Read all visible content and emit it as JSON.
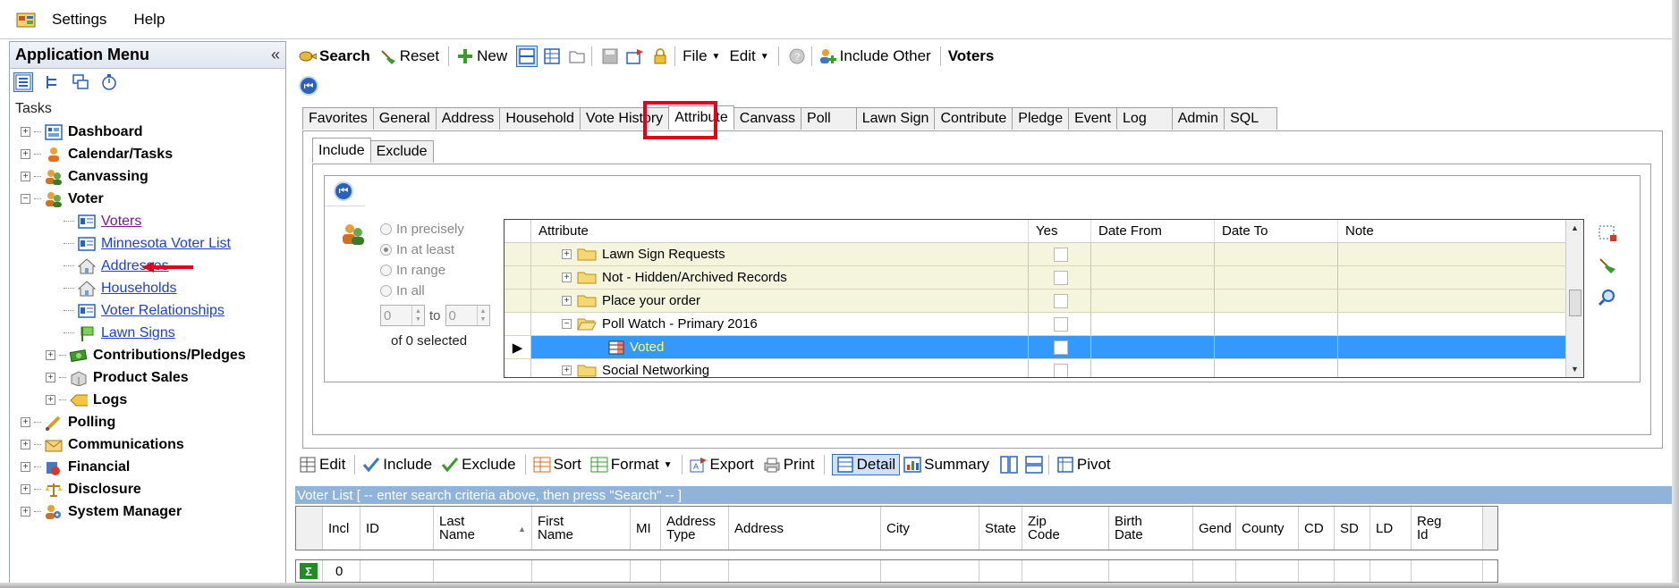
{
  "menubar": {
    "items": [
      "Settings",
      "Help"
    ]
  },
  "left_panel": {
    "title": "Application Menu",
    "collapse_glyph": "«",
    "tasks_label": "Tasks",
    "tree": [
      {
        "label": "Dashboard",
        "expander": "+",
        "icon": "dashboard-icon"
      },
      {
        "label": "Calendar/Tasks",
        "expander": "+",
        "icon": "calendar-person-icon"
      },
      {
        "label": "Canvassing",
        "expander": "+",
        "icon": "people-icon"
      },
      {
        "label": "Voter",
        "expander": "−",
        "icon": "people-icon",
        "children": [
          {
            "label": "Voters",
            "icon": "card-icon",
            "visited": true
          },
          {
            "label": "Minnesota Voter List",
            "icon": "card-icon"
          },
          {
            "label": "Addresses",
            "icon": "house-icon"
          },
          {
            "label": "Households",
            "icon": "house-icon"
          },
          {
            "label": "Voter Relationships",
            "icon": "card-icon"
          },
          {
            "label": "Lawn Signs",
            "icon": "sign-icon"
          }
        ],
        "subgroups": [
          {
            "label": "Contributions/Pledges",
            "icon": "money-icon"
          },
          {
            "label": "Product Sales",
            "icon": "box-icon"
          },
          {
            "label": "Logs",
            "icon": "tag-icon"
          }
        ]
      },
      {
        "label": "Polling",
        "expander": "+",
        "icon": "pen-icon"
      },
      {
        "label": "Communications",
        "expander": "+",
        "icon": "envelope-icon"
      },
      {
        "label": "Financial",
        "expander": "+",
        "icon": "money-bag-icon"
      },
      {
        "label": "Disclosure",
        "expander": "+",
        "icon": "scale-icon"
      },
      {
        "label": "System Manager",
        "expander": "+",
        "icon": "people-gear-icon"
      }
    ]
  },
  "toolbar": {
    "search": "Search",
    "reset": "Reset",
    "new": "New",
    "file": "File",
    "edit": "Edit",
    "include_other": "Include Other",
    "title": "Voters"
  },
  "tabs": [
    "Favorites",
    "General",
    "Address",
    "Household",
    "Vote History",
    "Attribute",
    "Canvass",
    "Poll",
    "Lawn Sign",
    "Contribute",
    "Pledge",
    "Event",
    "Log",
    "Admin",
    "SQL"
  ],
  "active_tab": "Attribute",
  "subtabs": [
    "Include",
    "Exclude"
  ],
  "options": {
    "precisely": "In precisely",
    "at_least": "In at least",
    "range": "In range",
    "all": "In all",
    "from_value": "0",
    "to_label": "to",
    "to_value": "0",
    "selected_info": "of 0 selected"
  },
  "attr_grid": {
    "columns": [
      "Attribute",
      "Yes",
      "Date From",
      "Date To",
      "Note"
    ],
    "rows": [
      {
        "label": "Lawn Sign Requests",
        "style": "yellow",
        "type": "folder"
      },
      {
        "label": "Not - Hidden/Archived Records",
        "style": "yellow",
        "type": "folder"
      },
      {
        "label": "Place your order",
        "style": "yellow",
        "type": "folder"
      },
      {
        "label": "Poll Watch - Primary 2016",
        "style": "plain",
        "type": "folder-open"
      },
      {
        "label": "Voted",
        "style": "selected",
        "type": "leaf"
      },
      {
        "label": "Social Networking",
        "style": "plain",
        "type": "folder"
      }
    ]
  },
  "bottom_toolbar": {
    "edit": "Edit",
    "include": "Include",
    "exclude": "Exclude",
    "sort": "Sort",
    "format": "Format",
    "export": "Export",
    "print": "Print",
    "detail": "Detail",
    "summary": "Summary",
    "pivot": "Pivot"
  },
  "voter_list": {
    "caption": "Voter List  [ -- enter search criteria above, then press \"Search\" -- ]",
    "columns": [
      "Incl",
      "ID",
      "Last Name",
      "First Name",
      "MI",
      "Address Type",
      "Address",
      "City",
      "State",
      "Zip Code",
      "Birth Date",
      "Gend",
      "County",
      "CD",
      "SD",
      "LD",
      "Reg Id"
    ],
    "footer_count": "0"
  },
  "colors": {
    "accent_blue": "#3399ff",
    "highlight_red": "#e4001b",
    "voted_text": "#ffff66",
    "caption_bar": "#8fb3d9"
  }
}
